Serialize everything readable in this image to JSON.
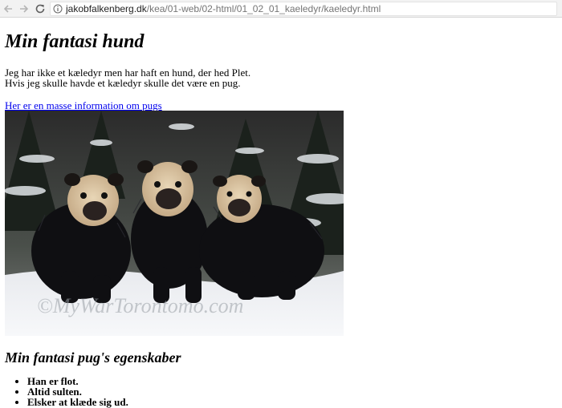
{
  "browser": {
    "url_host": "jakobfalkenberg.dk",
    "url_path": "/kea/01-web/02-html/01_02_01_kaeledyr/kaeledyr.html"
  },
  "page": {
    "title": "Min fantasi hund",
    "intro_line1": "Jeg har ikke et kæledyr men har haft en hund, der hed Plet.",
    "intro_line2": "Hvis jeg skulle havde et kæledyr skulle det være en pug.",
    "link_text": "Her er en masse information om pugs",
    "image_watermark": "©MyWarTorontomo.com",
    "subtitle": "Min fantasi pug's egenskaber",
    "traits": [
      "Han er flot.",
      "Altid sulten.",
      "Elsker at klæde sig ud."
    ]
  }
}
